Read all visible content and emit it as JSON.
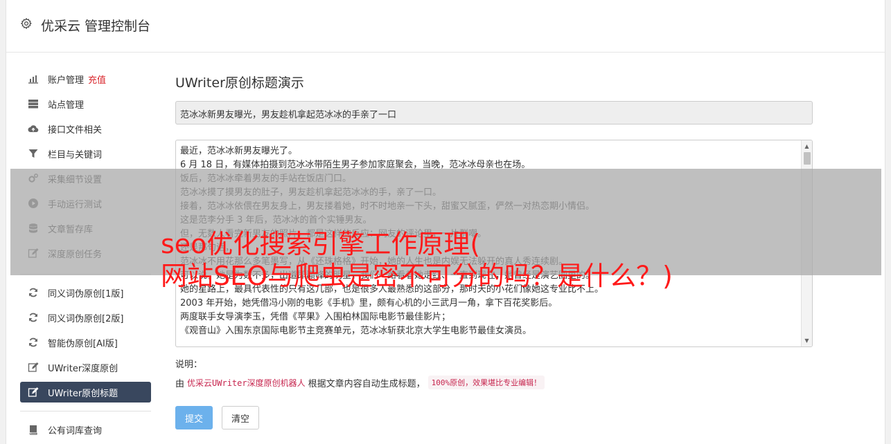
{
  "header": {
    "title": "优采云 管理控制台",
    "icon": "gear-icon"
  },
  "sidebar": {
    "group1": [
      {
        "label": "账户管理",
        "badge": "充值",
        "icon": "bar-chart-icon"
      },
      {
        "label": "站点管理",
        "icon": "server-icon"
      },
      {
        "label": "接口文件相关",
        "icon": "cloud-upload-icon"
      },
      {
        "label": "栏目与关键词",
        "icon": "filter-icon"
      },
      {
        "label": "采集细节设置",
        "icon": "cogs-icon"
      },
      {
        "label": "手动运行测试",
        "icon": "play-circle-icon"
      },
      {
        "label": "文章暂存库",
        "icon": "database-icon"
      },
      {
        "label": "深度原创任务",
        "icon": "edit-icon"
      }
    ],
    "group2": [
      {
        "label": "同义词伪原创[1版]",
        "icon": "refresh-icon"
      },
      {
        "label": "同义词伪原创[2版]",
        "icon": "refresh-icon"
      },
      {
        "label": "智能伪原创[AI版]",
        "icon": "refresh-icon"
      },
      {
        "label": "UWriter深度原创",
        "icon": "edit-icon"
      },
      {
        "label": "UWriter原创标题",
        "icon": "edit-icon",
        "active": true
      }
    ],
    "group3": [
      {
        "label": "公有词库查询",
        "icon": "book-icon"
      }
    ]
  },
  "main": {
    "heading": "UWriter原创标题演示",
    "title_value": "范冰冰新男友曝光，男友趁机拿起范冰冰的手亲了一口",
    "article_lines": [
      "最近，范冰冰新男友曝光了。",
      "6 月 18 日，有媒体拍摄到范冰冰带陌生男子参加家庭聚会，当晚，范冰冰母亲也在场。",
      "饭后，范冰冰牵着男友的手站在饭店门口。",
      "范冰冰摸了摸男友的肚子，男友趁机拿起范冰冰的手，亲了一口。",
      "接着，范冰冰依偎在男友身上，男友搂着她，时不时地亲一下头，甜蜜又腻歪，俨然一对热恋期小情侣。",
      "这是范李分手 3 年后，范冰冰的首个实锤男友。",
      "但，无数人看完新男友的照片，都是这样的反应：网友的评论里，一片群嘲。",
      "还是那句话，",
      "范冰冰不用花那么多笔墨写，从《还珠格格》开始，她的人生也是内娱无法躲开的真人秀连续剧。",
      "可以说，她是为数不多，出道即巅峰的明星，我们一路看着她走红、一直到现在，她曾经是演艺圈里的。",
      "她的星路上，最具代表性的只有这几部，也是很多人最熟悉的这部分，那时天的小花们像她这专业比不上。",
      "2003 年开始，她凭借冯小刚的电影《手机》里，颇有心机的小三武月一角，拿下百花奖影后。",
      "两度联手女导演李玉，凭借《苹果》入围柏林国际电影节最佳影片；",
      "《观音山》入围东京国际电影节主竞赛单元，范冰冰斩获北京大学生电影节最佳女演员。"
    ],
    "note_label": "说明：",
    "note_prefix": "由",
    "note_link": "优采云UWriter深度原创机器人",
    "note_middle": "根据文章内容自动生成标题，",
    "note_pill": "100%原创，效果堪比专业编辑！",
    "submit_label": "提交",
    "clear_label": "清空"
  },
  "overlay": {
    "line1": "seo优化搜索引擎工作原理(",
    "line2": "网站SEO与爬虫是密不可分的吗？是什么？)"
  },
  "colors": {
    "active_nav": "#39475e",
    "primary_button": "#6cb1ec",
    "overlay_text": "#ff1a1a",
    "badge": "#d9262c"
  }
}
